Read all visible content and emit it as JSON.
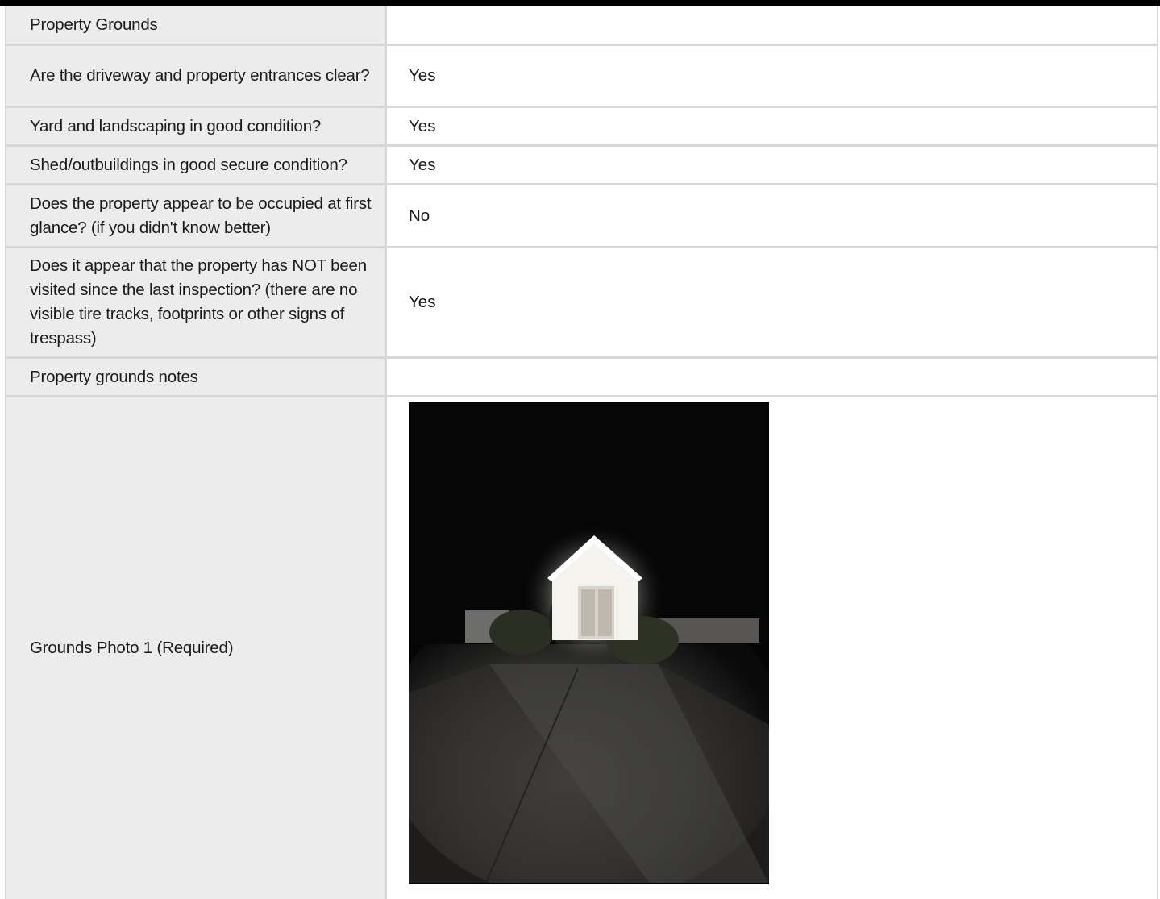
{
  "section": {
    "title": "Property Grounds"
  },
  "rows": [
    {
      "question": "Are the driveway and property entrances clear?",
      "answer": "Yes"
    },
    {
      "question": "Yard and landscaping in good condition?",
      "answer": "Yes"
    },
    {
      "question": "Shed/outbuildings in good secure condition?",
      "answer": "Yes"
    },
    {
      "question": "Does the property appear to be occupied at first glance? (if you didn't know better)",
      "answer": "No"
    },
    {
      "question": "Does it appear that the property has NOT been visited since the last inspection? (there are no visible tire tracks, footprints or other signs of trespass)",
      "answer": "Yes"
    },
    {
      "question": "Property grounds notes",
      "answer": ""
    }
  ],
  "photo_row": {
    "label": "Grounds Photo 1 (Required)"
  },
  "colors": {
    "label_bg": "#ececec",
    "border": "#d7d7d7",
    "header_bar": "#000000"
  }
}
